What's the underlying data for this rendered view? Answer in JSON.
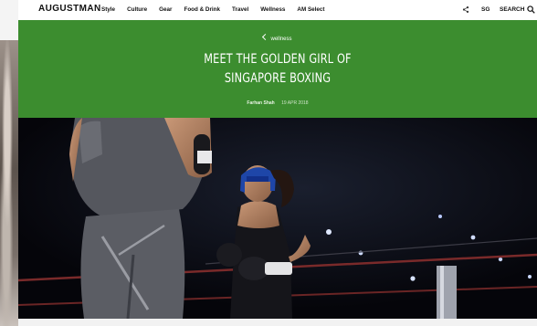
{
  "header": {
    "logo": "AUGUSTMAN",
    "nav": [
      "Style",
      "Culture",
      "Gear",
      "Food & Drink",
      "Travel",
      "Wellness",
      "AM Select"
    ],
    "region": "SG",
    "search_label": "SEARCH"
  },
  "article": {
    "category": "wellness",
    "title": "MEET THE GOLDEN GIRL OF SINGAPORE BOXING",
    "author": "Farhan Shah",
    "date": "19 APR 2018"
  },
  "colors": {
    "hero_green": "#3c8d2f",
    "text_dark": "#111111",
    "photo_bg": "#07070c"
  },
  "icons": [
    "share-icon",
    "search-icon",
    "check-icon"
  ]
}
